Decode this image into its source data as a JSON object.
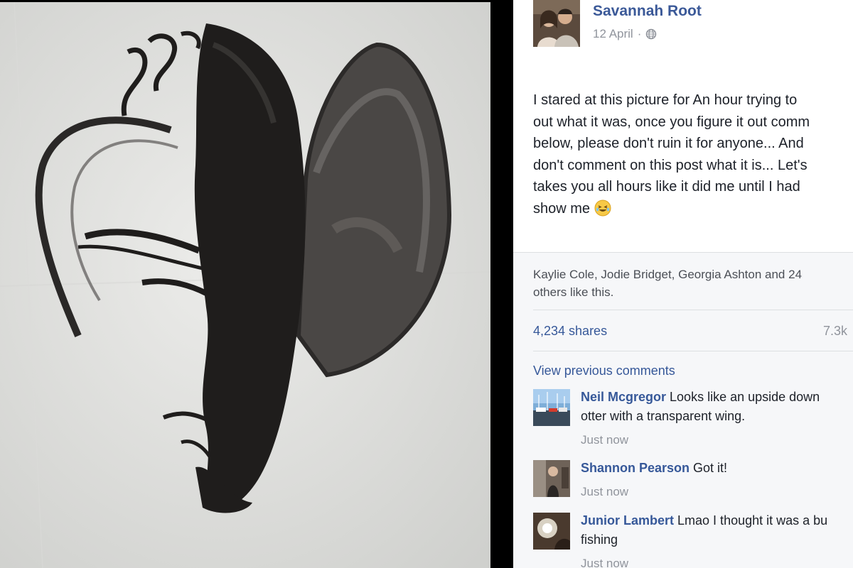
{
  "post": {
    "author": "Savannah Root",
    "date": "12 April",
    "separator": "·",
    "privacy_icon": "globe-icon",
    "body_lines": [
      "I stared at this picture for An hour trying to",
      "out what it was, once you figure it out comm",
      "below, please don't ruin it for anyone... And",
      "don't comment on this post what it is... Let's",
      "takes you all hours like it did me until I had",
      "show me"
    ],
    "body_emoji": "laughing-tears-emoji"
  },
  "engagement": {
    "likes_lines": [
      "Kaylie Cole, Jodie Bridget, Georgia Ashton and 24",
      "others like this."
    ],
    "shares": "4,234 shares",
    "comments_count": "7.3k",
    "view_previous": "View previous comments"
  },
  "comments": [
    {
      "author": "Neil Mcgregor",
      "lines": [
        " Looks like an upside down",
        "otter with a transparent wing."
      ],
      "time": "Just now"
    },
    {
      "author": "Shannon Pearson",
      "lines": [
        " Got it!"
      ],
      "time": "Just now"
    },
    {
      "author": "Junior Lambert",
      "lines": [
        " Lmao I thought it was a bu",
        "fishing"
      ],
      "time": "Just now"
    }
  ],
  "colors": {
    "link_blue": "#365899",
    "name_blue": "#3b5998",
    "meta_grey": "#90949c",
    "text_dark": "#1d2129"
  }
}
